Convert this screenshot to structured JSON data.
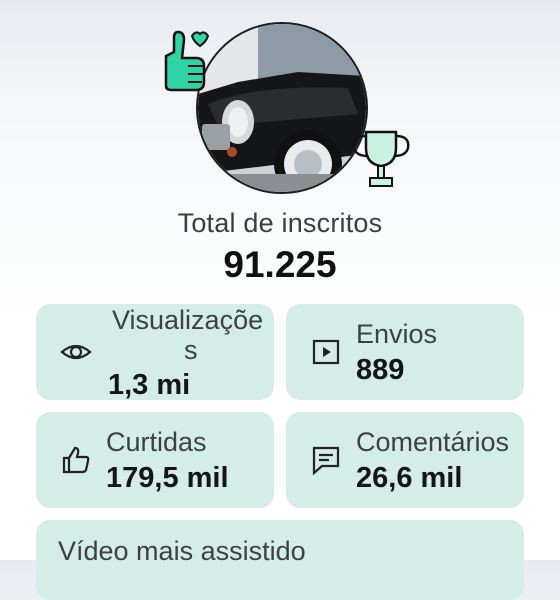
{
  "header": {
    "total_label": "Total de inscritos",
    "total_value": "91.225"
  },
  "stats": {
    "views": {
      "icon": "eye-icon",
      "label_line1": "Visualizaçõe",
      "label_line2": "s",
      "value": "1,3 mi"
    },
    "uploads": {
      "icon": "play-box-icon",
      "label": "Envios",
      "value": "889"
    },
    "likes": {
      "icon": "thumbs-up-icon",
      "label": "Curtidas",
      "value": "179,5 mil"
    },
    "comments": {
      "icon": "comment-icon",
      "label": "Comentários",
      "value": "26,6 mil"
    }
  },
  "top_video": {
    "label": "Vídeo mais assistido"
  },
  "colors": {
    "card_bg": "#d5ede7",
    "badge_green": "#2fd3a6",
    "text_dark": "#151515"
  }
}
